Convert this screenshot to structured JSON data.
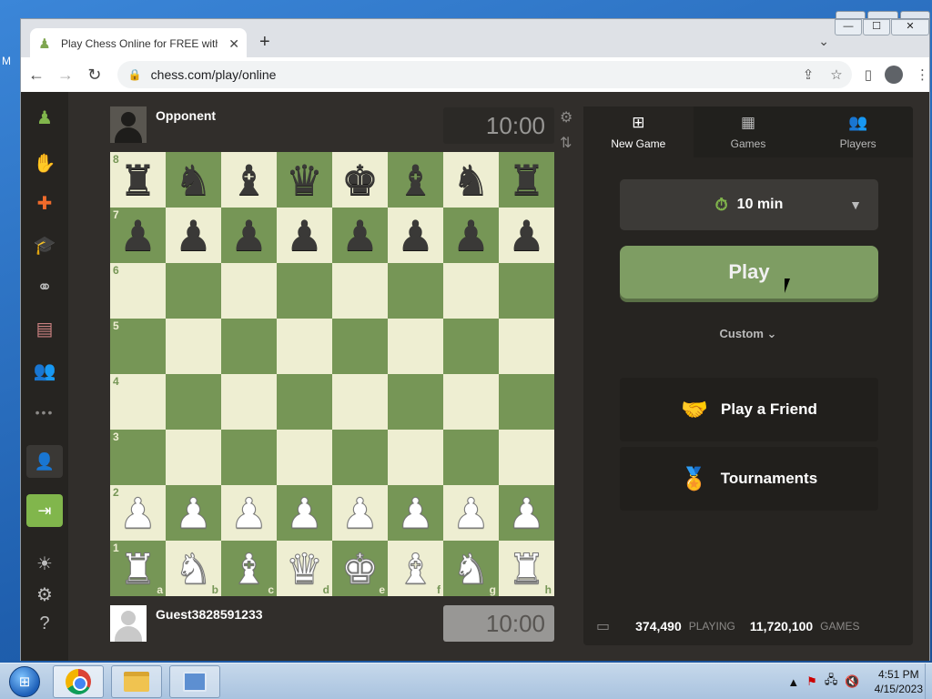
{
  "desktop": {
    "edge_label": "M"
  },
  "browser": {
    "tab": {
      "title": "Play Chess Online for FREE with Friends",
      "close": "✕"
    },
    "new_tab": "+",
    "tab_menu": "⌄",
    "window_controls": {
      "minimize": "—",
      "maximize": "☐",
      "close": "✕"
    },
    "nav": {
      "back": "←",
      "forward": "→",
      "reload": "↻"
    },
    "url": "chess.com/play/online"
  },
  "sidebar": {
    "more": "•••"
  },
  "opponent": {
    "name": "Opponent",
    "clock": "10:00"
  },
  "me": {
    "name": "Guest3828591233",
    "clock": "10:00"
  },
  "board": {
    "ranks": [
      "8",
      "7",
      "6",
      "5",
      "4",
      "3",
      "2",
      "1"
    ],
    "files": [
      "a",
      "b",
      "c",
      "d",
      "e",
      "f",
      "g",
      "h"
    ],
    "position": [
      [
        "bR",
        "bN",
        "bB",
        "bQ",
        "bK",
        "bB",
        "bN",
        "bR"
      ],
      [
        "bP",
        "bP",
        "bP",
        "bP",
        "bP",
        "bP",
        "bP",
        "bP"
      ],
      [
        "",
        "",
        "",
        "",
        "",
        "",
        "",
        ""
      ],
      [
        "",
        "",
        "",
        "",
        "",
        "",
        "",
        ""
      ],
      [
        "",
        "",
        "",
        "",
        "",
        "",
        "",
        ""
      ],
      [
        "",
        "",
        "",
        "",
        "",
        "",
        "",
        ""
      ],
      [
        "wP",
        "wP",
        "wP",
        "wP",
        "wP",
        "wP",
        "wP",
        "wP"
      ],
      [
        "wR",
        "wN",
        "wB",
        "wQ",
        "wK",
        "wB",
        "wN",
        "wR"
      ]
    ]
  },
  "panel": {
    "tabs": [
      {
        "label": "New Game",
        "icon": "plus-square-icon"
      },
      {
        "label": "Games",
        "icon": "checkerboard-icon"
      },
      {
        "label": "Players",
        "icon": "players-icon"
      }
    ],
    "time_control": "10 min",
    "play_label": "Play",
    "custom_label": "Custom",
    "play_friend_label": "Play a Friend",
    "tournaments_label": "Tournaments",
    "stats": {
      "playing_count": "374,490",
      "playing_label": "PLAYING",
      "games_count": "11,720,100",
      "games_label": "GAMES"
    }
  },
  "taskbar": {
    "time": "4:51 PM",
    "date": "4/15/2023"
  },
  "colors": {
    "board_light": "#eeeed2",
    "board_dark": "#769656",
    "play_button": "#7e9d63",
    "page_bg": "#312e2b"
  }
}
